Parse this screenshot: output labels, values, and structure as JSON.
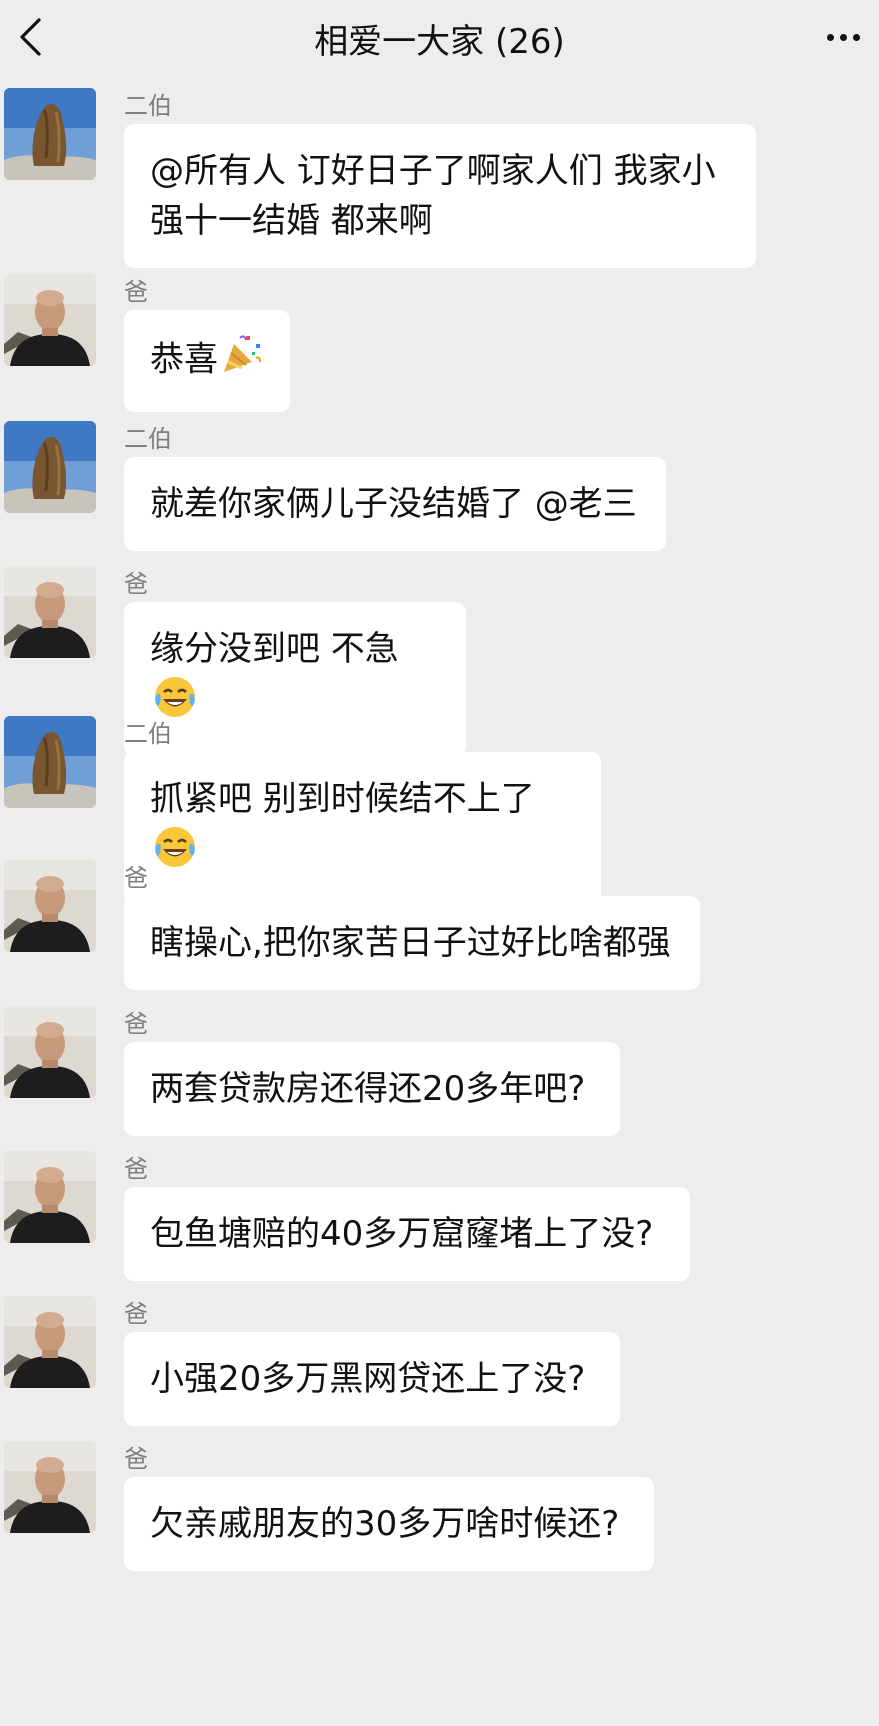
{
  "header": {
    "title": "相爱一大家 (26)"
  },
  "messages": [
    {
      "sender": "二伯",
      "avatar": "rock-avatar",
      "text": "@所有人 订好日子了啊家人们 我家小强十一结婚 都来啊",
      "emoji": ""
    },
    {
      "sender": "爸",
      "avatar": "man-avatar",
      "text": "恭喜",
      "emoji": "party-popper-emoji"
    },
    {
      "sender": "二伯",
      "avatar": "rock-avatar",
      "text": "就差你家俩儿子没结婚了 @老三",
      "emoji": ""
    },
    {
      "sender": "爸",
      "avatar": "man-avatar",
      "text": "缘分没到吧 不急",
      "emoji": "laughing-crying-emoji"
    },
    {
      "sender": "二伯",
      "avatar": "rock-avatar",
      "text": "抓紧吧 别到时候结不上了",
      "emoji": "laughing-crying-emoji"
    },
    {
      "sender": "爸",
      "avatar": "man-avatar",
      "text": "瞎操心,把你家苦日子过好比啥都强",
      "emoji": ""
    },
    {
      "sender": "爸",
      "avatar": "man-avatar",
      "text": "两套贷款房还得还20多年吧?",
      "emoji": ""
    },
    {
      "sender": "爸",
      "avatar": "man-avatar",
      "text": "包鱼塘赔的40多万窟窿堵上了没?",
      "emoji": ""
    },
    {
      "sender": "爸",
      "avatar": "man-avatar",
      "text": "小强20多万黑网贷还上了没?",
      "emoji": ""
    },
    {
      "sender": "爸",
      "avatar": "man-avatar",
      "text": "欠亲戚朋友的30多万啥时候还?",
      "emoji": ""
    }
  ],
  "colors": {
    "background": "#ededed",
    "bubble": "#ffffff",
    "sender_name": "#7f7f7f"
  }
}
